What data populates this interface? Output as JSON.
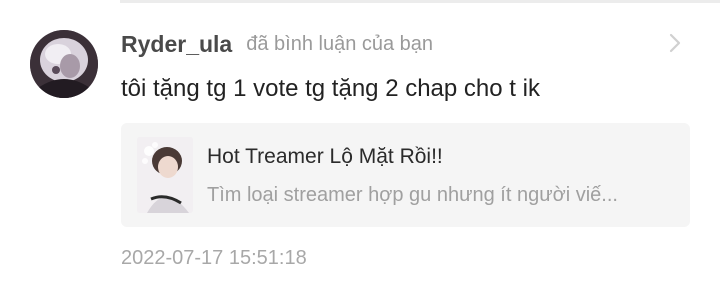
{
  "comment": {
    "username": "Ryder_ula",
    "action": "đã bình luận của bạn",
    "text": "tôi tặng tg 1 vote tg tặng 2 chap cho t ik",
    "timestamp": "2022-07-17 15:51:18"
  },
  "story": {
    "title": "Hot Treamer Lộ Mặt Rồi!!",
    "description": "Tìm loại streamer hợp gu nhưng ít người viế..."
  },
  "icons": {
    "chevron": "chevron-right-icon",
    "avatar": "avatar",
    "cover": "story-cover"
  }
}
